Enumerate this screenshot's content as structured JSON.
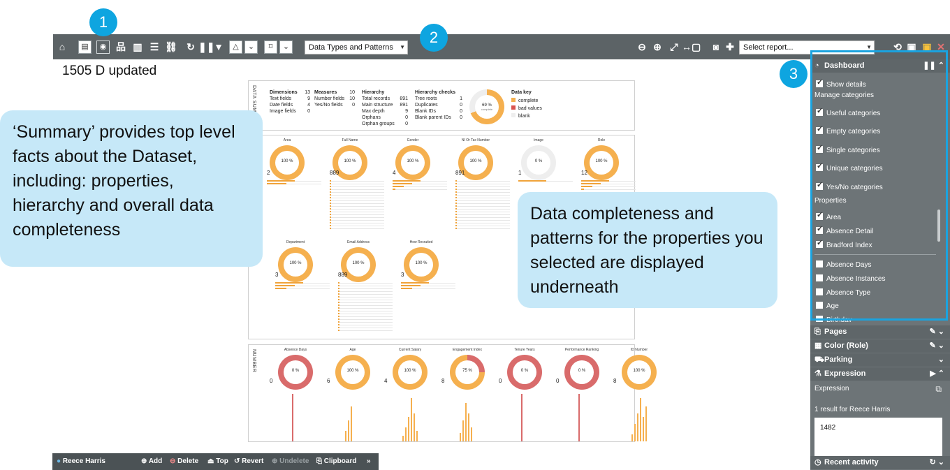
{
  "toolbar": {
    "report_dropdown": "Data Types and Patterns",
    "select_report": "Select report..."
  },
  "badges": {
    "b1": "1",
    "b2": "2",
    "b3": "3"
  },
  "document": {
    "title": "1505 D updated"
  },
  "summary": {
    "section_label": "DATA SUMMARY",
    "dimensions": {
      "heading": "Dimensions",
      "heading_value": "13",
      "rows": [
        {
          "label": "Text fields",
          "value": "9"
        },
        {
          "label": "Date fields",
          "value": "4"
        },
        {
          "label": "Image fields",
          "value": "0"
        }
      ]
    },
    "measures": {
      "heading": "Measures",
      "heading_value": "10",
      "rows": [
        {
          "label": "Number fields",
          "value": "10"
        },
        {
          "label": "Yes/No fields",
          "value": "0"
        }
      ]
    },
    "hierarchy": {
      "heading": "Hierarchy",
      "rows": [
        {
          "label": "Total records",
          "value": "891"
        },
        {
          "label": "Main structure",
          "value": "891"
        },
        {
          "label": "Max depth",
          "value": "9"
        },
        {
          "label": "Orphans",
          "value": "0"
        },
        {
          "label": "Orphan groups",
          "value": "0"
        }
      ]
    },
    "checks": {
      "heading": "Hierarchy checks",
      "rows": [
        {
          "label": "Tree roots",
          "value": "1"
        },
        {
          "label": "Duplicates",
          "value": "0"
        },
        {
          "label": "Blank IDs",
          "value": "0"
        },
        {
          "label": "Blank parent IDs",
          "value": "0"
        }
      ]
    },
    "donut_pct": "69 %",
    "donut_sub": "complete",
    "key": {
      "heading": "Data key",
      "items": [
        {
          "label": "complete",
          "color": "#f5b04f"
        },
        {
          "label": "bad values",
          "color": "#d9534f"
        },
        {
          "label": "blank",
          "color": "#eeeeee"
        }
      ]
    }
  },
  "text_props": [
    {
      "name": "Area",
      "pct": "100 %",
      "count": "2",
      "fill": 1.0
    },
    {
      "name": "Full Name",
      "pct": "100 %",
      "count": "889",
      "fill": 1.0
    },
    {
      "name": "Gender",
      "pct": "100 %",
      "count": "4",
      "fill": 1.0
    },
    {
      "name": "NI Or Tax Number",
      "pct": "100 %",
      "count": "891",
      "fill": 1.0
    },
    {
      "name": "Image",
      "pct": "0 %",
      "count": "1",
      "fill": 0.0
    },
    {
      "name": "Role",
      "pct": "100 %",
      "count": "12",
      "fill": 1.0
    },
    {
      "name": "Department",
      "pct": "100 %",
      "count": "3",
      "fill": 1.0
    },
    {
      "name": "Email Address",
      "pct": "100 %",
      "count": "889",
      "fill": 1.0
    },
    {
      "name": "How Recruited",
      "pct": "100 %",
      "count": "3",
      "fill": 1.0
    }
  ],
  "number_section_label": "NUMBER",
  "number_props": [
    {
      "name": "Absence Days",
      "pct": "0 %",
      "count": "0",
      "fill": 0.0
    },
    {
      "name": "Age",
      "pct": "100 %",
      "count": "6",
      "fill": 1.0
    },
    {
      "name": "Current Salary",
      "pct": "100 %",
      "count": "4",
      "fill": 1.0
    },
    {
      "name": "Engagement Index",
      "pct": "75 %",
      "count": "8",
      "fill": 0.75
    },
    {
      "name": "Tenure Years",
      "pct": "0 %",
      "count": "0",
      "fill": 0.0
    },
    {
      "name": "Performance Ranking",
      "pct": "0 %",
      "count": "0",
      "fill": 0.0
    },
    {
      "name": "ID Number",
      "pct": "100 %",
      "count": "8",
      "fill": 1.0
    }
  ],
  "callouts": {
    "summary": "‘Summary’ provides top level facts about the Dataset, including: properties, hierarchy and overall data completeness",
    "completeness": "Data completeness and patterns for the properties you selected are displayed underneath"
  },
  "right_panel": {
    "dashboard": "Dashboard",
    "show_details": "Show details",
    "manage_categories": "Manage categories",
    "categories": [
      {
        "label": "Useful categories",
        "checked": true
      },
      {
        "label": "Empty categories",
        "checked": true
      },
      {
        "label": "Single categories",
        "checked": true
      },
      {
        "label": "Unique categories",
        "checked": true
      },
      {
        "label": "Yes/No categories",
        "checked": true
      }
    ],
    "properties_label": "Properties",
    "properties": [
      {
        "label": "Area",
        "checked": true
      },
      {
        "label": "Absence Detail",
        "checked": true
      },
      {
        "label": "Bradford Index",
        "checked": true
      },
      {
        "label": "Absence Days",
        "checked": false
      },
      {
        "label": "Absence Instances",
        "checked": false
      },
      {
        "label": "Absence Type",
        "checked": false
      },
      {
        "label": "Age",
        "checked": false
      },
      {
        "label": "Birthday",
        "checked": false
      }
    ],
    "pages": "Pages",
    "color_role": "Color (Role)",
    "parking": "Parking",
    "expression": "Expression",
    "expression_label": "Expression",
    "result_text": "1 result for Reece Harris",
    "result_value": "1482",
    "recent_activity": "Recent activity"
  },
  "bottombar": {
    "user": "Reece Harris",
    "add": "Add",
    "delete": "Delete",
    "top": "Top",
    "revert": "Revert",
    "undelete": "Undelete",
    "clipboard": "Clipboard"
  }
}
